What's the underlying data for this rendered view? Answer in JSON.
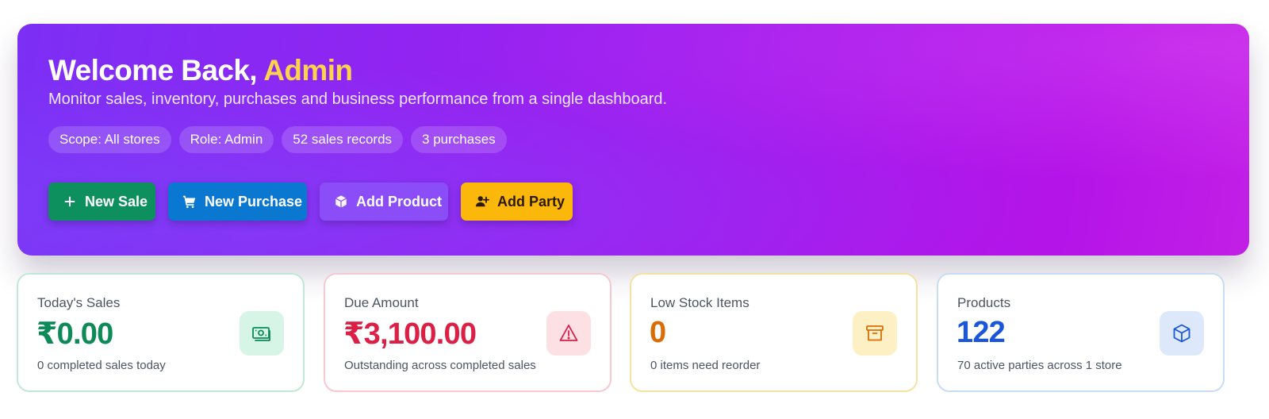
{
  "hero": {
    "title_prefix": "Welcome Back,",
    "title_name": "Admin",
    "subtitle": "Monitor sales, inventory, purchases and business performance from a single dashboard.",
    "chips": [
      {
        "label": "Scope: All stores"
      },
      {
        "label": "Role: Admin"
      },
      {
        "label": "52 sales records"
      },
      {
        "label": "3 purchases"
      }
    ],
    "actions": [
      {
        "label": "New Sale",
        "icon": "plus-icon",
        "color": "#0e8f5e"
      },
      {
        "label": "New Purchase",
        "icon": "cart-icon",
        "color": "#0a78d1"
      },
      {
        "label": "Add Product",
        "icon": "cube-icon",
        "color": "#8b4df7"
      },
      {
        "label": "Add Party",
        "icon": "user-plus-icon",
        "color": "#fbb70a"
      }
    ],
    "gradient": [
      "#7c2ff5",
      "#c21fe6"
    ],
    "accent_color": "#fcd34d"
  },
  "stats": [
    {
      "label": "Today's Sales",
      "value": "₹0.00",
      "note": "0 completed sales today",
      "icon": "cash-icon",
      "color": "#0c8a58"
    },
    {
      "label": "Due Amount",
      "value": "₹3,100.00",
      "note": "Outstanding across completed sales",
      "icon": "warning-icon",
      "color": "#dc1f45"
    },
    {
      "label": "Low Stock Items",
      "value": "0",
      "note": "0 items need reorder",
      "icon": "archive-box-icon",
      "color": "#d96e06"
    },
    {
      "label": "Products",
      "value": "122",
      "note": "70 active parties across 1 store",
      "icon": "cube-icon",
      "color": "#1a56db"
    }
  ]
}
